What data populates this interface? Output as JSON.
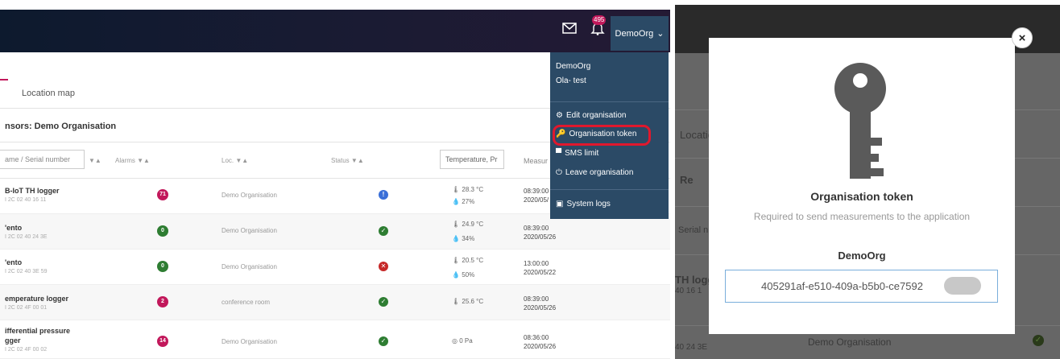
{
  "header": {
    "notification_count": "495",
    "org_button_label": "DemoOrg",
    "org_button_caret": "⌄"
  },
  "tabs": {
    "location_map": "Location map"
  },
  "sensors_title": "nsors: Demo Organisation",
  "filters": {
    "name_placeholder": "ame / Serial number",
    "alarms_label": "Alarms ▼▲",
    "loc_label": "Loc. ▼▲",
    "status_label": "Status ▼▲",
    "name_sort": "▼▲",
    "temperature_label": "Temperature, Pr",
    "measure_label": "Measur"
  },
  "rows": [
    {
      "name": "B-IoT TH logger",
      "serial": "I 2C 02 40 16 11",
      "alarms": "71",
      "alarm_color": "#c2185b",
      "location": "Demo Organisation",
      "status": "!",
      "status_color": "#3a6fd8",
      "temp": "28.3 °C",
      "hum": "27%",
      "time": "08:39:00",
      "date": "2020/05/"
    },
    {
      "name": "'ento",
      "serial": "I 2C 02 40 24 3E",
      "alarms": "0",
      "alarm_color": "#2e7d32",
      "location": "Demo Organisation",
      "status": "✓",
      "status_color": "#2e7d32",
      "temp": "24.9 °C",
      "hum": "34%",
      "time": "08:39:00",
      "date": "2020/05/26"
    },
    {
      "name": "'ento",
      "serial": "I 2C 02 40 3E 59",
      "alarms": "0",
      "alarm_color": "#2e7d32",
      "location": "Demo Organisation",
      "status": "✕",
      "status_color": "#c62828",
      "temp": "20.5 °C",
      "hum": "50%",
      "time": "13:00:00",
      "date": "2020/05/22"
    },
    {
      "name": "emperature logger",
      "serial": "I 2C 02 4F 00 01",
      "alarms": "2",
      "alarm_color": "#c2185b",
      "location": "conference room",
      "status": "✓",
      "status_color": "#2e7d32",
      "temp": "25.6 °C",
      "hum": "",
      "time": "08:39:00",
      "date": "2020/05/26"
    },
    {
      "name": "ifferential pressure",
      "name2": "gger",
      "serial": "I 2C 02 4F 00 02",
      "alarms": "14",
      "alarm_color": "#c2185b",
      "location": "Demo Organisation",
      "status": "✓",
      "status_color": "#2e7d32",
      "temp": "0 Pa",
      "hum": "",
      "time": "08:36:00",
      "date": "2020/05/26"
    }
  ],
  "dropdown": {
    "orgs": [
      "DemoOrg",
      "Ola- test"
    ],
    "edit_organisation": "Edit organisation",
    "organisation_token": "Organisation token",
    "sms_limit": "SMS limit",
    "leave_organisation": "Leave organisation",
    "system_logs": "System logs"
  },
  "modal": {
    "close_label": "×",
    "title": "Organisation token",
    "subtitle": "Required to send measurements to the application",
    "org_name": "DemoOrg",
    "token_value": "405291af-e510-409a-b5b0-ce7592"
  },
  "background_right": {
    "location_tab": "Locatio",
    "remove_label": "Re",
    "serial_header": "Serial n",
    "row1_name": "TH logg",
    "row1_serial": "40 16 1",
    "row2_serial": "40 24 3E",
    "row2_loc": "Demo Organisation"
  }
}
